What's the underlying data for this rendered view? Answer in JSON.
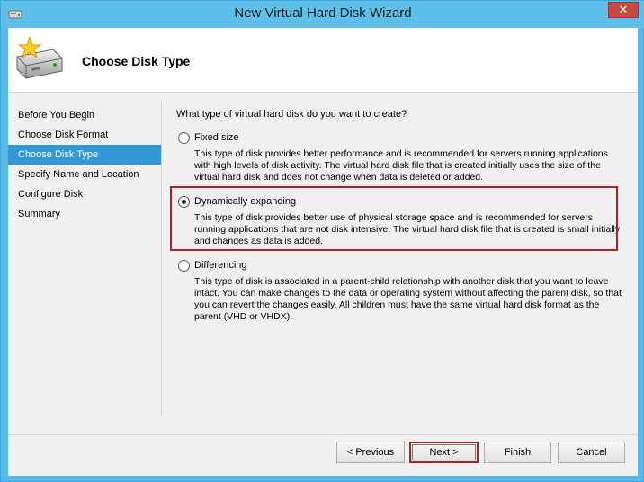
{
  "window": {
    "title": "New Virtual Hard Disk Wizard",
    "close_label": "✕"
  },
  "header": {
    "title": "Choose Disk Type"
  },
  "nav": {
    "items": [
      {
        "label": "Before You Begin"
      },
      {
        "label": "Choose Disk Format"
      },
      {
        "label": "Choose Disk Type"
      },
      {
        "label": "Specify Name and Location"
      },
      {
        "label": "Configure Disk"
      },
      {
        "label": "Summary"
      }
    ],
    "selected_index": 2
  },
  "content": {
    "question": "What type of virtual hard disk do you want to create?",
    "options": [
      {
        "label": "Fixed size",
        "description": "This type of disk provides better performance and is recommended for servers running applications with high levels of disk activity. The virtual hard disk file that is created initially uses the size of the virtual hard disk and does not change when data is deleted or added.",
        "checked": false
      },
      {
        "label": "Dynamically expanding",
        "description": "This type of disk provides better use of physical storage space and is recommended for servers running applications that are not disk intensive. The virtual hard disk file that is created is small initially and changes as data is added.",
        "checked": true
      },
      {
        "label": "Differencing",
        "description": "This type of disk is associated in a parent-child relationship with another disk that you want to leave intact. You can make changes to the data or operating system without affecting the parent disk, so that you can revert the changes easily. All children must have the same virtual hard disk format as the parent (VHD or VHDX).",
        "checked": false
      }
    ]
  },
  "buttons": {
    "previous": "< Previous",
    "next": "Next >",
    "finish": "Finish",
    "cancel": "Cancel"
  },
  "colors": {
    "titlebar": "#5ec0ea",
    "selected_nav": "#3399d6",
    "highlight_border": "#b0202a",
    "close_button": "#c7483f"
  },
  "icons": {
    "app": "disk-icon",
    "header": "new-disk-icon"
  }
}
